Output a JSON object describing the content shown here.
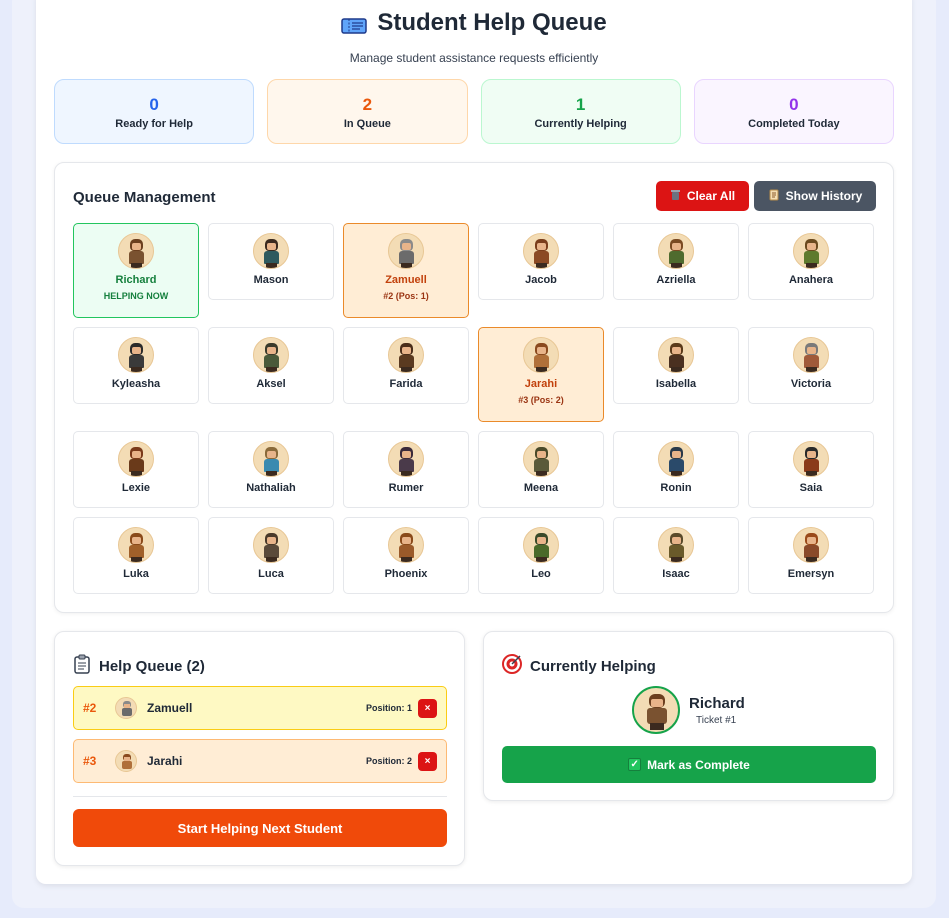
{
  "header": {
    "title": "Student Help Queue",
    "subtitle": "Manage student assistance requests efficiently"
  },
  "stats": [
    {
      "value": "0",
      "label": "Ready for Help"
    },
    {
      "value": "2",
      "label": "In Queue"
    },
    {
      "value": "1",
      "label": "Currently Helping"
    },
    {
      "value": "0",
      "label": "Completed Today"
    }
  ],
  "queue_management": {
    "title": "Queue Management",
    "clear_label": "Clear All",
    "history_label": "Show History"
  },
  "students": [
    {
      "name": "Richard",
      "status": "helping",
      "sub": "HELPING NOW",
      "hair": "#6b3f1f",
      "cloth": "#7a5230"
    },
    {
      "name": "Mason",
      "status": "",
      "sub": "",
      "hair": "#3b2a1f",
      "cloth": "#2f5a5e"
    },
    {
      "name": "Zamuell",
      "status": "queued",
      "sub": "#2 (Pos: 1)",
      "hair": "#8a8a8a",
      "cloth": "#6b6b6b"
    },
    {
      "name": "Jacob",
      "status": "",
      "sub": "",
      "hair": "#7a3e1c",
      "cloth": "#8b4a24"
    },
    {
      "name": "Azriella",
      "status": "",
      "sub": "",
      "hair": "#7a4a22",
      "cloth": "#4f6b2e"
    },
    {
      "name": "Anahera",
      "status": "",
      "sub": "",
      "hair": "#6b4a1f",
      "cloth": "#5e7a2e"
    },
    {
      "name": "Kyleasha",
      "status": "",
      "sub": "",
      "hair": "#2b2b2b",
      "cloth": "#3a3a3a"
    },
    {
      "name": "Aksel",
      "status": "",
      "sub": "",
      "hair": "#3b3b2b",
      "cloth": "#4a5a3a"
    },
    {
      "name": "Farida",
      "status": "",
      "sub": "",
      "hair": "#4a2e1a",
      "cloth": "#5a3a20"
    },
    {
      "name": "Jarahi",
      "status": "queued",
      "sub": "#3 (Pos: 2)",
      "hair": "#8a4a1f",
      "cloth": "#b0703a"
    },
    {
      "name": "Isabella",
      "status": "",
      "sub": "",
      "hair": "#5a3a1a",
      "cloth": "#4a3020"
    },
    {
      "name": "Victoria",
      "status": "",
      "sub": "",
      "hair": "#7a7a7a",
      "cloth": "#a05a3a"
    },
    {
      "name": "Lexie",
      "status": "",
      "sub": "",
      "hair": "#7a3a1a",
      "cloth": "#6a3a1a"
    },
    {
      "name": "Nathaliah",
      "status": "",
      "sub": "",
      "hair": "#8a6a3a",
      "cloth": "#3a8ab0"
    },
    {
      "name": "Rumer",
      "status": "",
      "sub": "",
      "hair": "#3a2a3a",
      "cloth": "#4a3a4a"
    },
    {
      "name": "Meena",
      "status": "",
      "sub": "",
      "hair": "#4a4a2a",
      "cloth": "#5a5a3a"
    },
    {
      "name": "Ronin",
      "status": "",
      "sub": "",
      "hair": "#2a3a4a",
      "cloth": "#2a4a6a"
    },
    {
      "name": "Saia",
      "status": "",
      "sub": "",
      "hair": "#2a2a2a",
      "cloth": "#8a3a1a"
    },
    {
      "name": "Luka",
      "status": "",
      "sub": "",
      "hair": "#8a4a1a",
      "cloth": "#a0602a"
    },
    {
      "name": "Luca",
      "status": "",
      "sub": "",
      "hair": "#4a3a2a",
      "cloth": "#5a4a3a"
    },
    {
      "name": "Phoenix",
      "status": "",
      "sub": "",
      "hair": "#8a4a1a",
      "cloth": "#9a5a2a"
    },
    {
      "name": "Leo",
      "status": "",
      "sub": "",
      "hair": "#3a4a2a",
      "cloth": "#4a6a2a"
    },
    {
      "name": "Isaac",
      "status": "",
      "sub": "",
      "hair": "#5a4a2a",
      "cloth": "#6a5a2a"
    },
    {
      "name": "Emersyn",
      "status": "",
      "sub": "",
      "hair": "#9a4a1a",
      "cloth": "#8a4a2a"
    }
  ],
  "help_queue": {
    "title": "Help Queue (2)",
    "items": [
      {
        "ticket": "#2",
        "name": "Zamuell",
        "position": "Position: 1",
        "remove": "×"
      },
      {
        "ticket": "#3",
        "name": "Jarahi",
        "position": "Position: 2",
        "remove": "×"
      }
    ],
    "next_label": "Start Helping Next Student"
  },
  "currently_helping": {
    "title": "Currently Helping",
    "name": "Richard",
    "ticket": "Ticket #1",
    "complete_label": "Mark as Complete"
  },
  "colors": {
    "accent_orange": "#f04a0a",
    "danger": "#dc1414",
    "success": "#16a34a",
    "neutral": "#4b5563"
  }
}
